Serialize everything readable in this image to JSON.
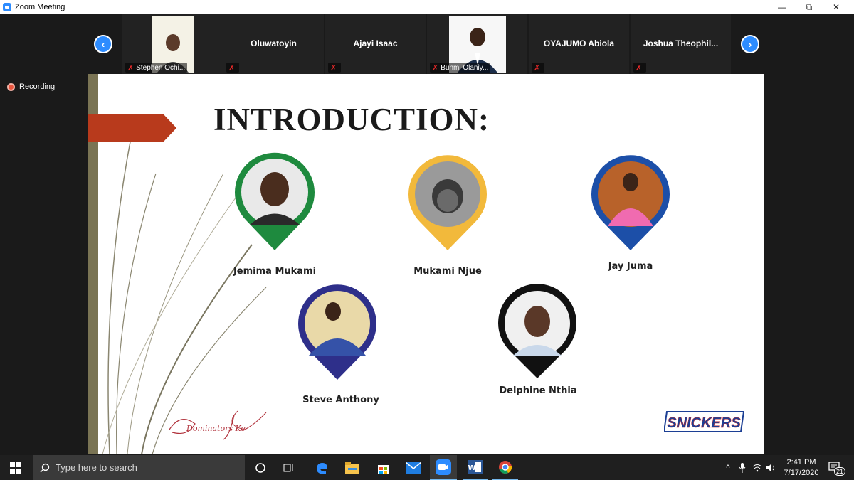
{
  "window": {
    "title": "Zoom Meeting",
    "controls": {
      "minimize": "—",
      "restore": "⧉",
      "close": "✕"
    }
  },
  "participants": [
    {
      "name": "Stephen Ochi...",
      "label_position": "footer",
      "has_video": true
    },
    {
      "name": "Oluwatoyin",
      "label_position": "center",
      "has_video": false
    },
    {
      "name": "Ajayi Isaac",
      "label_position": "center",
      "has_video": false
    },
    {
      "name": "Bunmi Olaniy...",
      "label_position": "footer",
      "has_video": true
    },
    {
      "name": "OYAJUMO Abiola",
      "label_position": "center",
      "has_video": false
    },
    {
      "name": "Joshua Theophil...",
      "label_position": "center",
      "has_video": false
    }
  ],
  "nav": {
    "prev_icon": "chevron-left-icon",
    "next_icon": "chevron-right-icon",
    "prev_glyph": "‹",
    "next_glyph": "›"
  },
  "recording": {
    "label": "Recording",
    "color": "#e8553e"
  },
  "slide": {
    "heading": "INTRODUCTION:",
    "accent_color": "#b83a1c",
    "people": [
      {
        "name": "Jemima Mukami",
        "pin_color": "#1e8a3e"
      },
      {
        "name": "Mukami Njue",
        "pin_color": "#f2b93b"
      },
      {
        "name": "Jay Juma",
        "pin_color": "#1c4fa8"
      },
      {
        "name": "Steve Anthony",
        "pin_color": "#2e2f8a"
      },
      {
        "name": "Delphine Nthia",
        "pin_color": "#111111"
      }
    ],
    "signature_text": "Dominators Ke",
    "logo_text": "SNICKERS",
    "logo_color": "#1c3f94"
  },
  "taskbar": {
    "search_placeholder": "Type here to search",
    "apps": [
      "cortana-icon",
      "task-view-icon",
      "edge-icon",
      "file-explorer-icon",
      "store-icon",
      "mail-icon",
      "zoom-icon",
      "word-icon",
      "chrome-icon"
    ],
    "time": "2:41 PM",
    "date": "7/17/2020",
    "notification_count": "21"
  }
}
